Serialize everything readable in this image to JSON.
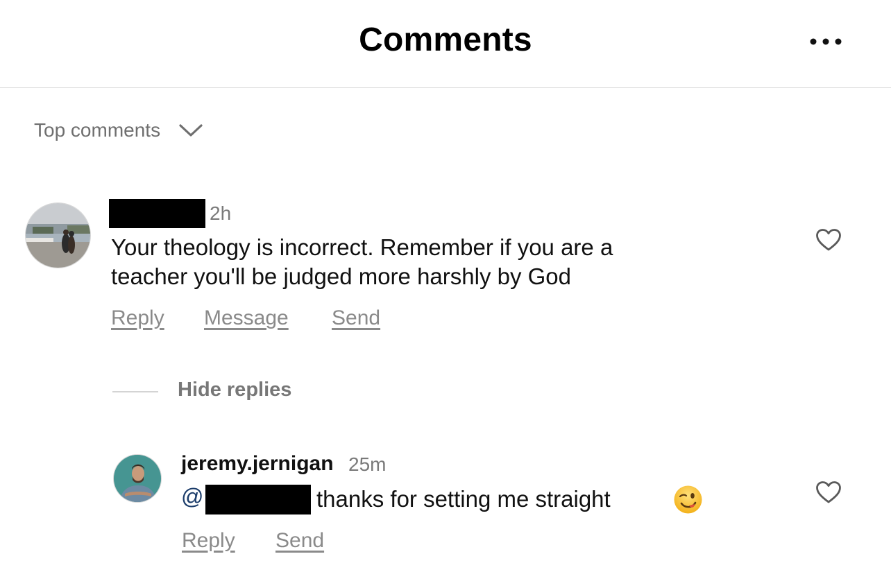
{
  "header": {
    "title": "Comments",
    "more_icon": "more-horizontal-icon"
  },
  "sort": {
    "label": "Top comments",
    "icon": "chevron-down-icon"
  },
  "comments": [
    {
      "username": "",
      "username_redacted": true,
      "timestamp": "2h",
      "text_line1": "Your theology is incorrect. Remember if you are a",
      "text_line2": "teacher you'll be judged more harshly by God",
      "actions": {
        "reply": "Reply",
        "message": "Message",
        "send": "Send"
      },
      "like_icon": "heart-icon",
      "hide_replies": "Hide replies",
      "replies": [
        {
          "username": "jeremy.jernigan",
          "timestamp": "25m",
          "mention_prefix": "@",
          "mention_redacted": true,
          "text": "thanks for setting me straight",
          "emoji": "😉",
          "actions": {
            "reply": "Reply",
            "send": "Send"
          },
          "like_icon": "heart-icon"
        }
      ]
    }
  ],
  "colors": {
    "text": "#111111",
    "secondary": "#7a7a7a",
    "divider": "#dcdcdc",
    "mention": "#1c3d6b"
  }
}
